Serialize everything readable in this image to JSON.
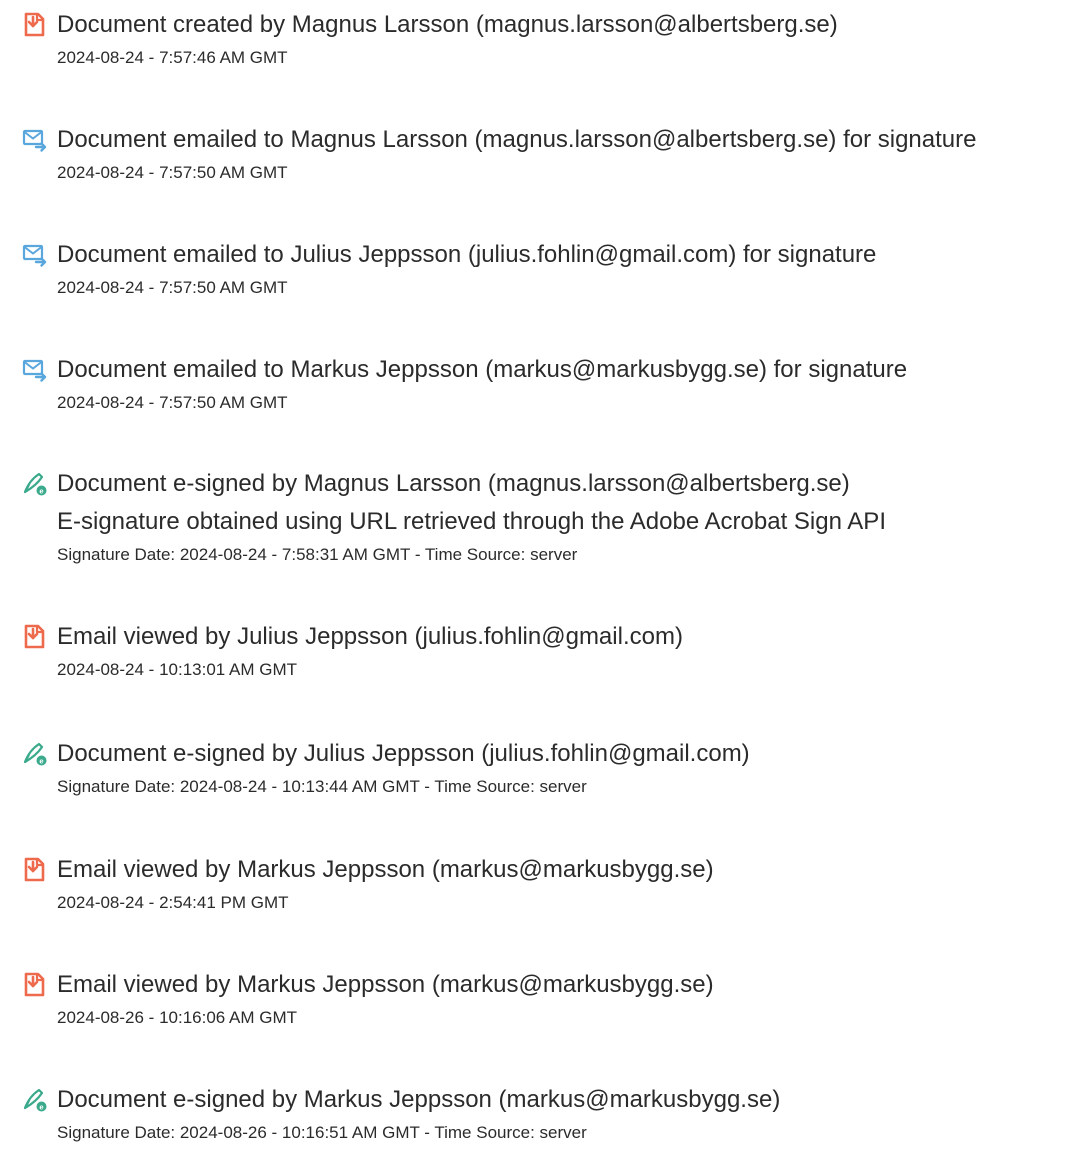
{
  "events": [
    {
      "icon": "document-icon",
      "title": "Document created by Magnus Larsson (magnus.larsson@albertsberg.se)",
      "timestamp": "2024-08-24 - 7:57:46 AM GMT"
    },
    {
      "icon": "email-icon",
      "title": "Document emailed to Magnus Larsson (magnus.larsson@albertsberg.se) for signature",
      "timestamp": "2024-08-24 - 7:57:50 AM GMT"
    },
    {
      "icon": "email-icon",
      "title": "Document emailed to Julius Jeppsson (julius.fohlin@gmail.com) for signature",
      "timestamp": "2024-08-24 - 7:57:50 AM GMT"
    },
    {
      "icon": "email-icon",
      "title": "Document emailed to Markus Jeppsson (markus@markusbygg.se) for signature",
      "timestamp": "2024-08-24 - 7:57:50 AM GMT"
    },
    {
      "icon": "esign-icon",
      "title": "Document e-signed by Magnus Larsson (magnus.larsson@albertsberg.se)",
      "detail": "E-signature obtained using URL retrieved through the Adobe Acrobat Sign API",
      "timestamp": "Signature Date: 2024-08-24 - 7:58:31 AM GMT - Time Source: server"
    },
    {
      "icon": "document-icon",
      "title": "Email viewed by Julius Jeppsson (julius.fohlin@gmail.com)",
      "timestamp": "2024-08-24 - 10:13:01 AM GMT"
    },
    {
      "icon": "esign-icon",
      "title": "Document e-signed by Julius Jeppsson (julius.fohlin@gmail.com)",
      "timestamp": "Signature Date: 2024-08-24 - 10:13:44 AM GMT - Time Source: server"
    },
    {
      "icon": "document-icon",
      "title": "Email viewed by Markus Jeppsson (markus@markusbygg.se)",
      "timestamp": "2024-08-24 - 2:54:41 PM GMT"
    },
    {
      "icon": "document-icon",
      "title": "Email viewed by Markus Jeppsson (markus@markusbygg.se)",
      "timestamp": "2024-08-26 - 10:16:06 AM GMT"
    },
    {
      "icon": "esign-icon",
      "title": "Document e-signed by Markus Jeppsson (markus@markusbygg.se)",
      "timestamp": "Signature Date: 2024-08-26 - 10:16:51 AM GMT - Time Source: server"
    }
  ],
  "colors": {
    "document_icon": "#EE6A4D",
    "email_icon": "#5AA7DE",
    "esign_icon": "#3BAA8C",
    "text": "#2B2B2B"
  }
}
